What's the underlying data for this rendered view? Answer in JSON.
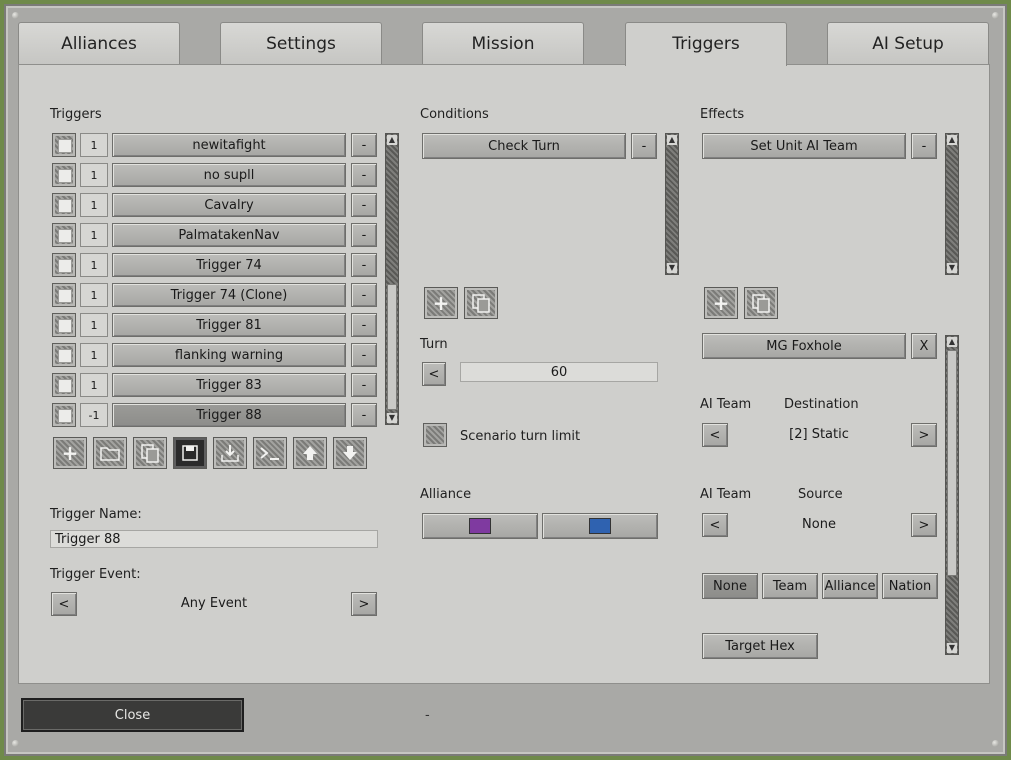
{
  "tabs": [
    {
      "label": "Alliances"
    },
    {
      "label": "Settings"
    },
    {
      "label": "Mission"
    },
    {
      "label": "Triggers"
    },
    {
      "label": "AI Setup"
    }
  ],
  "triggers": {
    "heading": "Triggers",
    "rows": [
      {
        "num": "1",
        "name": "newitafight"
      },
      {
        "num": "1",
        "name": "no supll"
      },
      {
        "num": "1",
        "name": "Cavalry"
      },
      {
        "num": "1",
        "name": "PalmatakenNav"
      },
      {
        "num": "1",
        "name": "Trigger 74"
      },
      {
        "num": "1",
        "name": "Trigger 74 (Clone)"
      },
      {
        "num": "1",
        "name": "Trigger 81"
      },
      {
        "num": "1",
        "name": "flanking warning"
      },
      {
        "num": "1",
        "name": "Trigger 83"
      },
      {
        "num": "-1",
        "name": "Trigger 88"
      }
    ],
    "remove_label": "-",
    "name_label": "Trigger Name:",
    "name_value": "Trigger 88",
    "event_label": "Trigger Event:",
    "event_value": "Any Event",
    "prev": "<",
    "next": ">"
  },
  "conditions": {
    "heading": "Conditions",
    "items": [
      {
        "name": "Check Turn"
      }
    ],
    "remove_label": "-",
    "turn_label": "Turn",
    "turn_value": "60",
    "turn_prev": "<",
    "scenario_limit_label": "Scenario turn limit",
    "alliance_label": "Alliance",
    "alliance_colors": [
      "#7f3aa0",
      "#2f62b0"
    ]
  },
  "effects": {
    "heading": "Effects",
    "items": [
      {
        "name": "Set Unit AI Team"
      }
    ],
    "remove_label": "-",
    "unit_name": "MG Foxhole",
    "unit_remove": "X",
    "ai_team_label_1": "AI Team",
    "destination_label": "Destination",
    "destination_value": "[2] Static",
    "ai_team_label_2": "AI Team",
    "source_label": "Source",
    "source_value": "None",
    "prev": "<",
    "next": ">",
    "scope_buttons": [
      "None",
      "Team",
      "Alliance",
      "Nation"
    ],
    "target_hex": "Target Hex"
  },
  "footer": {
    "close": "Close",
    "dash": "-"
  }
}
